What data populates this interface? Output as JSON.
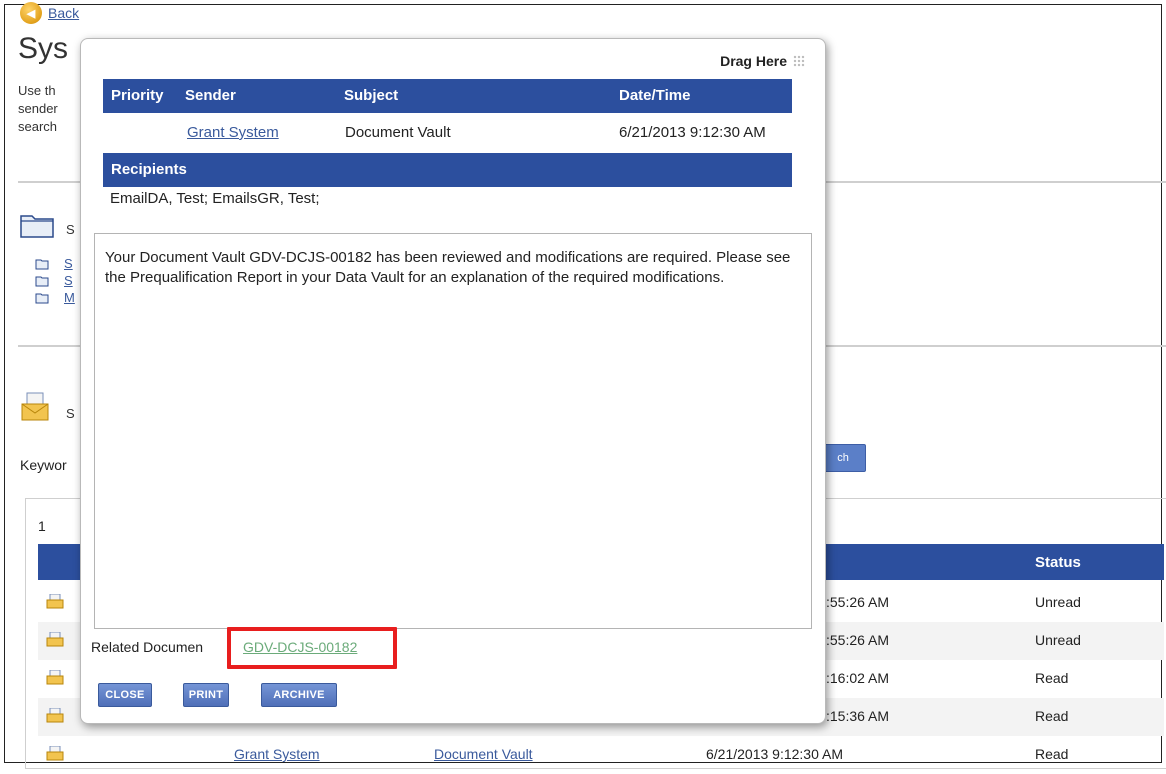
{
  "back": {
    "label": "Back"
  },
  "page": {
    "title_visible": "Sys",
    "desc_visible": [
      "Use th",
      "sender",
      "search"
    ],
    "folders_visible": [
      "S",
      "S",
      "S",
      "M"
    ],
    "mail_section_visible": "S",
    "keyword_label_visible": "Keywor",
    "search_button_visible": "ch"
  },
  "results": {
    "pager": "1",
    "status_header": "Status",
    "rows": [
      {
        "time": ":55:26 AM",
        "status": "Unread"
      },
      {
        "time": ":55:26 AM",
        "status": "Unread"
      },
      {
        "time": ":16:02 AM",
        "status": "Read"
      },
      {
        "time": ":15:36 AM",
        "status": "Read"
      },
      {
        "sender": "Grant System",
        "subject": "Document Vault",
        "time": "6/21/2013 9:12:30 AM",
        "status": "Read"
      }
    ]
  },
  "modal": {
    "drag_label": "Drag Here",
    "headers": {
      "priority": "Priority",
      "sender": "Sender",
      "subject": "Subject",
      "datetime": "Date/Time",
      "recipients": "Recipients"
    },
    "message": {
      "sender": "Grant System",
      "subject": "Document Vault",
      "datetime": "6/21/2013 9:12:30 AM",
      "recipients": "EmailDA, Test; EmailsGR, Test;",
      "body": "Your Document Vault GDV-DCJS-00182 has been reviewed and modifications are required. Please see the Prequalification Report in your Data Vault for an explanation of the required modifications."
    },
    "related_label": "Related Documen",
    "related_link": "GDV-DCJS-00182",
    "buttons": {
      "close": "CLOSE",
      "print": "PRINT",
      "archive": "ARCHIVE"
    }
  },
  "colors": {
    "header_bg": "#2c4f9e",
    "link": "#3a5a9c",
    "related_link": "#6bab7a",
    "highlight": "#e81e1e"
  }
}
